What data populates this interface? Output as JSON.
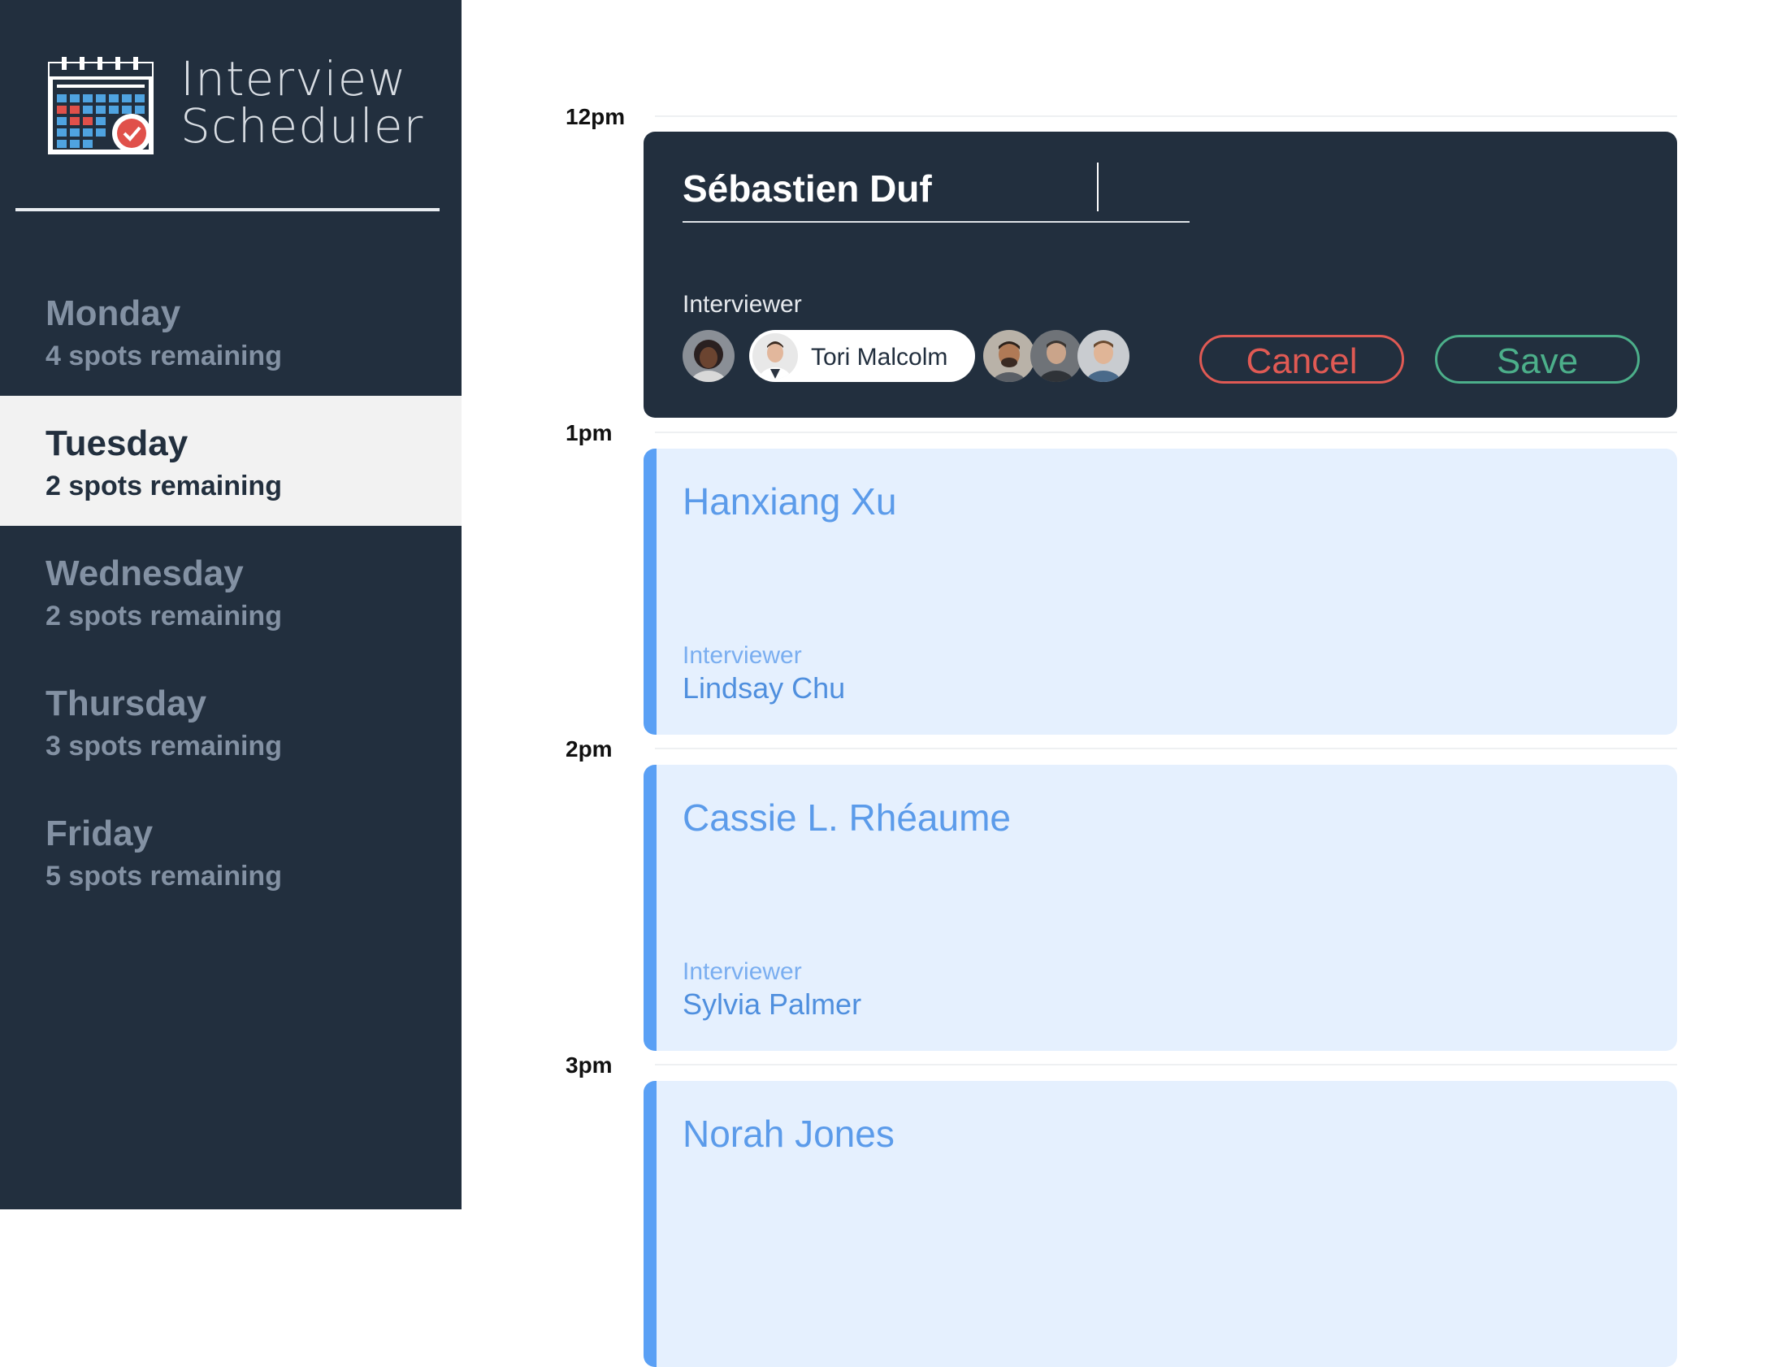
{
  "app": {
    "title_line1": "Interview",
    "title_line2": "Scheduler"
  },
  "days": [
    {
      "name": "Monday",
      "spots": "4 spots remaining"
    },
    {
      "name": "Tuesday",
      "spots": "2 spots remaining",
      "selected": true
    },
    {
      "name": "Wednesday",
      "spots": "2 spots remaining"
    },
    {
      "name": "Thursday",
      "spots": "3 spots remaining"
    },
    {
      "name": "Friday",
      "spots": "5 spots remaining"
    }
  ],
  "times": [
    "12pm",
    "1pm",
    "2pm",
    "3pm"
  ],
  "edit": {
    "student_value": "Sébastien Duf",
    "interviewer_label": "Interviewer",
    "selected_interviewer": "Tori Malcolm",
    "cancel_label": "Cancel",
    "save_label": "Save"
  },
  "appointments": [
    {
      "student": "Hanxiang Xu",
      "interviewer_label": "Interviewer",
      "interviewer": "Lindsay Chu"
    },
    {
      "student": "Cassie L. Rhéaume",
      "interviewer_label": "Interviewer",
      "interviewer": "Sylvia Palmer"
    },
    {
      "student": "Norah Jones"
    }
  ],
  "colors": {
    "sidebar_bg": "#222f3e",
    "selected_day_bg": "#f2f2f2",
    "cancel": "#e05a54",
    "save": "#4caf8a",
    "appointment_bg": "#e5f0fe",
    "appointment_accent": "#5aa0f5"
  }
}
